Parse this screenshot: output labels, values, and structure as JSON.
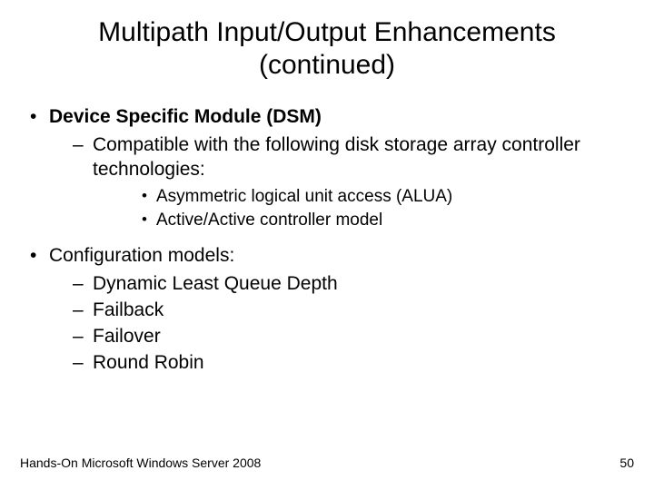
{
  "title": "Multipath Input/Output Enhancements\n(continued)",
  "bullets": {
    "b1": "Device Specific Module (DSM)",
    "b1_1": "Compatible with the following disk storage array controller technologies:",
    "b1_1_1": "Asymmetric logical unit access (ALUA)",
    "b1_1_2": "Active/Active controller model",
    "b2": "Configuration models:",
    "b2_1": "Dynamic Least Queue Depth",
    "b2_2": "Failback",
    "b2_3": "Failover",
    "b2_4": "Round Robin"
  },
  "footer": {
    "left": "Hands-On Microsoft Windows Server 2008",
    "page": "50"
  }
}
